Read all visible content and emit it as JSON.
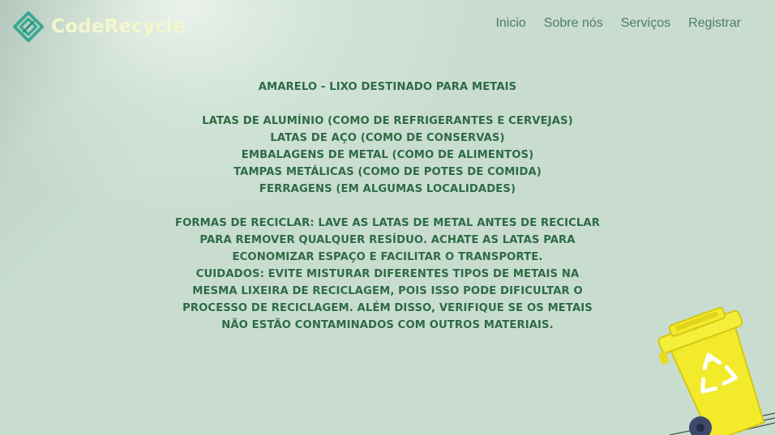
{
  "brand": {
    "name": "CodeRecycle",
    "logo_icon": "recycle-diamond-icon",
    "logo_color": "#3aa891",
    "text_color": "#f4f7cc"
  },
  "nav": {
    "items": [
      {
        "label": "Inicio"
      },
      {
        "label": "Sobre nós"
      },
      {
        "label": "Serviços"
      },
      {
        "label": "Registrar"
      }
    ]
  },
  "content": {
    "heading": "AMARELO - LIXO DESTINADO PARA METAIS",
    "items": [
      "LATAS DE ALUMÍNIO (COMO DE REFRIGERANTES E CERVEJAS)",
      "LATAS DE AÇO (COMO DE CONSERVAS)",
      "EMBALAGENS DE METAL (COMO DE ALIMENTOS)",
      "TAMPAS METÁLICAS (COMO DE POTES DE COMIDA)",
      "FERRAGENS (EM ALGUMAS LOCALIDADES)"
    ],
    "recycle_text": "FORMAS DE RECICLAR: LAVE AS LATAS DE METAL ANTES DE RECICLAR PARA REMOVER QUALQUER RESÍDUO. ACHATE AS LATAS PARA ECONOMIZAR ESPAÇO E FACILITAR O TRANSPORTE.",
    "care_text": "CUIDADOS: EVITE MISTURAR DIFERENTES TIPOS DE METAIS NA MESMA LIXEIRA DE RECICLAGEM, POIS ISSO PODE DIFICULTAR O PROCESSO DE RECICLAGEM. ALÉM DISSO, VERIFIQUE SE OS METAIS NÃO ESTÃO CONTAMINADOS COM OUTROS MATERIAIS."
  },
  "illustration": {
    "icon": "yellow-recycling-bin-icon",
    "bin_color": "#f2ea2a",
    "background_color": "#c8ddd0",
    "text_color": "#2e6b45",
    "nav_color": "#4f7a6b"
  }
}
